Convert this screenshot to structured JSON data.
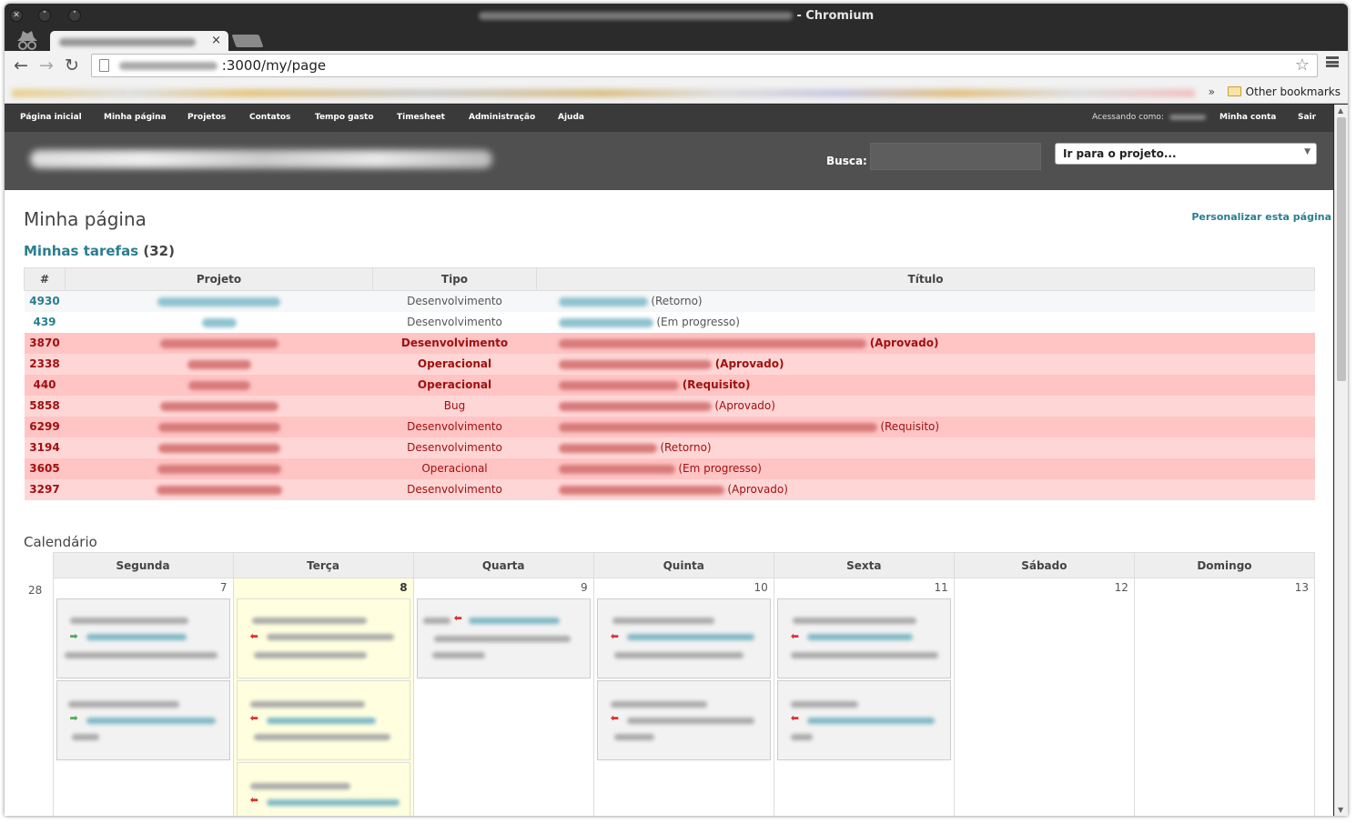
{
  "window": {
    "title_suffix": "- Chromium"
  },
  "tab": {
    "close_label": "×"
  },
  "toolbar": {
    "url": ":3000/my/page"
  },
  "bookmarks": {
    "overflow": "»",
    "other_label": "Other bookmarks"
  },
  "topmenu": {
    "items": [
      "Página inicial",
      "Minha página",
      "Projetos",
      "Contatos",
      "Tempo gasto",
      "Timesheet",
      "Administração",
      "Ajuda"
    ],
    "logged_as": "Acessando como:",
    "account": "Minha conta",
    "logout": "Sair"
  },
  "header": {
    "search_label": "Busca:",
    "project_jump": "Ir para o projeto..."
  },
  "page": {
    "title": "Minha página",
    "personalize": "Personalizar esta página",
    "issues_title": "Minhas tarefas",
    "issues_count": "(32)",
    "calendar_title": "Calendário"
  },
  "issues": {
    "columns": [
      "#",
      "Projeto",
      "Tipo",
      "Título"
    ],
    "rows": [
      {
        "id": "4930",
        "type": "Desenvolvimento",
        "status": "(Retorno)"
      },
      {
        "id": "439",
        "type": "Desenvolvimento",
        "status": "(Em progresso)"
      },
      {
        "id": "3870",
        "type": "Desenvolvimento",
        "status": "(Aprovado)"
      },
      {
        "id": "2338",
        "type": "Operacional",
        "status": "(Aprovado)"
      },
      {
        "id": "440",
        "type": "Operacional",
        "status": "(Requisito)"
      },
      {
        "id": "5858",
        "type": "Bug",
        "status": "(Aprovado)"
      },
      {
        "id": "6299",
        "type": "Desenvolvimento",
        "status": "(Requisito)"
      },
      {
        "id": "3194",
        "type": "Desenvolvimento",
        "status": "(Retorno)"
      },
      {
        "id": "3605",
        "type": "Operacional",
        "status": "(Em progresso)"
      },
      {
        "id": "3297",
        "type": "Desenvolvimento",
        "status": "(Aprovado)"
      }
    ]
  },
  "calendar": {
    "days": [
      "Segunda",
      "Terça",
      "Quarta",
      "Quinta",
      "Sexta",
      "Sábado",
      "Domingo"
    ],
    "week": "28",
    "dates": [
      "7",
      "8",
      "9",
      "10",
      "11",
      "12",
      "13"
    ]
  },
  "colors": {
    "link": "#2a7e8f",
    "topmenu": "#3a3a3a",
    "header": "#505050",
    "priority_high": "#ffc4c4",
    "priority_text": "#a01010",
    "today": "#ffffdd"
  }
}
